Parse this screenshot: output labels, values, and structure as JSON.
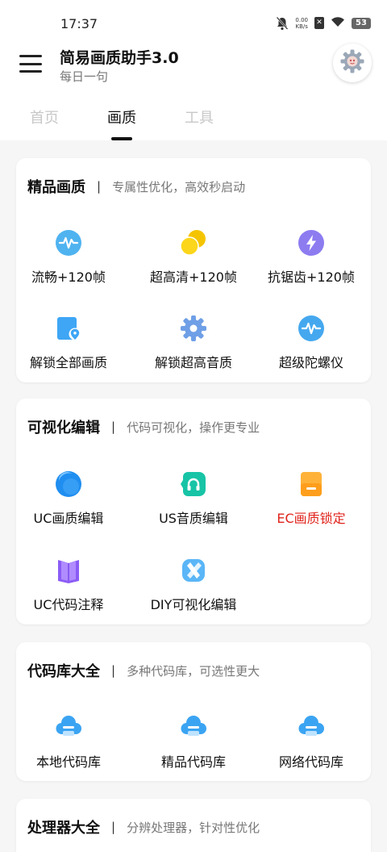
{
  "status": {
    "time": "17:37",
    "net_speed": "0.00",
    "net_unit": "KB/s",
    "battery": "53"
  },
  "header": {
    "title": "简易画质助手3.0",
    "subtitle": "每日一句"
  },
  "tabs": [
    {
      "label": "首页",
      "active": false
    },
    {
      "label": "画质",
      "active": true
    },
    {
      "label": "工具",
      "active": false
    }
  ],
  "sections": [
    {
      "title": "精品画质",
      "separator": "|",
      "desc": "专属性优化，高效秒启动",
      "items": [
        {
          "label": "流畅+120帧",
          "icon": "pulse-icon"
        },
        {
          "label": "超高清+120帧",
          "icon": "circles-icon"
        },
        {
          "label": "抗锯齿+120帧",
          "icon": "lightning-icon"
        },
        {
          "label": "解锁全部画质",
          "icon": "location-doc-icon"
        },
        {
          "label": "解锁超高音质",
          "icon": "gear-icon"
        },
        {
          "label": "超级陀螺仪",
          "icon": "pulse-icon"
        }
      ]
    },
    {
      "title": "可视化编辑",
      "separator": "|",
      "desc": "代码可视化，操作更专业",
      "items": [
        {
          "label": "UC画质编辑",
          "icon": "blue-ball-icon"
        },
        {
          "label": "US音质编辑",
          "icon": "headphones-icon"
        },
        {
          "label": "EC画质锁定",
          "icon": "folder-icon",
          "color": "#e0241c"
        },
        {
          "label": "UC代码注释",
          "icon": "book-icon"
        },
        {
          "label": "DIY可视化编辑",
          "icon": "x-shape-icon"
        }
      ]
    },
    {
      "title": "代码库大全",
      "separator": "|",
      "desc": "多种代码库，可选性更大",
      "items": [
        {
          "label": "本地代码库",
          "icon": "cloud-icon"
        },
        {
          "label": "精品代码库",
          "icon": "cloud-icon"
        },
        {
          "label": "网络代码库",
          "icon": "cloud-icon"
        }
      ]
    },
    {
      "title": "处理器大全",
      "separator": "|",
      "desc": "分辨处理器，针对性优化"
    }
  ]
}
